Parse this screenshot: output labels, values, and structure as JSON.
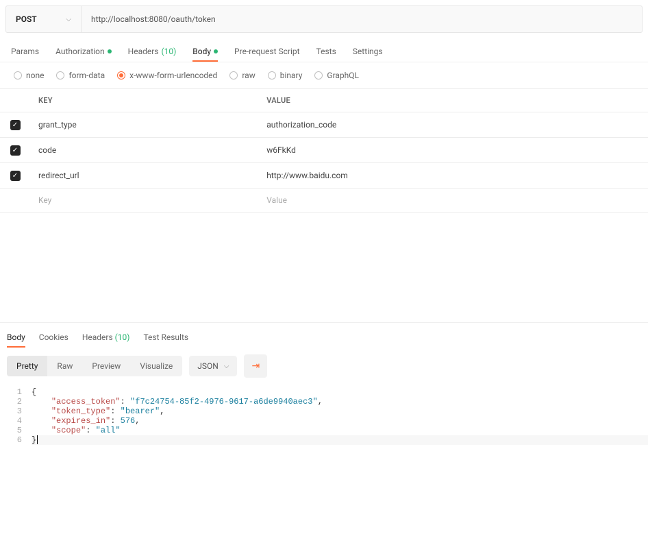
{
  "request": {
    "method": "POST",
    "url": "http://localhost:8080/oauth/token"
  },
  "req_tabs": {
    "params": "Params",
    "auth": "Authorization",
    "headers": "Headers",
    "headers_count": "(10)",
    "body": "Body",
    "prereq": "Pre-request Script",
    "tests": "Tests",
    "settings": "Settings"
  },
  "body_types": {
    "none": "none",
    "form": "form-data",
    "url": "x-www-form-urlencoded",
    "raw": "raw",
    "bin": "binary",
    "gql": "GraphQL"
  },
  "table": {
    "key_h": "KEY",
    "val_h": "VALUE",
    "rows": [
      {
        "key": "grant_type",
        "value": "authorization_code"
      },
      {
        "key": "code",
        "value": "w6FkKd"
      },
      {
        "key": "redirect_url",
        "value": "http://www.baidu.com"
      }
    ],
    "ph_key": "Key",
    "ph_value": "Value"
  },
  "resp_tabs": {
    "body": "Body",
    "cookies": "Cookies",
    "headers": "Headers",
    "headers_count": "(10)",
    "results": "Test Results"
  },
  "view": {
    "pretty": "Pretty",
    "raw": "Raw",
    "preview": "Preview",
    "visualize": "Visualize",
    "format": "JSON"
  },
  "response_json": {
    "k1": "\"access_token\"",
    "v1": "\"f7c24754-85f2-4976-9617-a6de9940aec3\"",
    "k2": "\"token_type\"",
    "v2": "\"bearer\"",
    "k3": "\"expires_in\"",
    "v3": "576",
    "k4": "\"scope\"",
    "v4": "\"all\""
  }
}
